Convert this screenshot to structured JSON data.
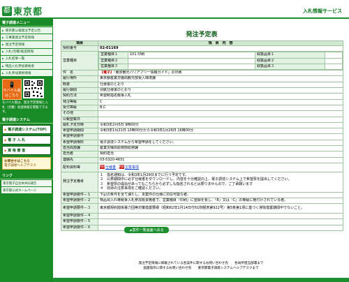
{
  "header": {
    "logo_text": "東京都",
    "logo_mark": "都",
    "service_title": "入札情報サービス"
  },
  "sidebar": {
    "menu_heading": "電子調達メニュー",
    "menu_items": [
      "東京都公報発注予定公告",
      "工事業発注予定情報",
      "発注予定情報",
      "入札(見積)経過情報",
      "入札結果一覧",
      "物品入札参加資格者",
      "入札参加資格情報"
    ],
    "mobile_label": "モバイル版",
    "mobile_sub": "はこちら",
    "mobile_text": "モバイル版は、発注予定情報と入札（見積）経過情報を閲覧できます。",
    "system_heading": "電子調達システム",
    "system_buttons": [
      "電子調達システム(TOP)",
      "電 子 入 札",
      "資 格 審 査"
    ],
    "promo_title": "お問合せはこちら",
    "promo_text": "電子調達ヘルプデスク",
    "links_heading": "リンク",
    "links": [
      "東京電子自治体共同運営",
      "東京都公式ホームページ"
    ]
  },
  "page_title": "発注予定表",
  "table": {
    "header_item": "項目",
    "header_content": "項　目　内　容",
    "contract_no_label": "契約番号",
    "contract_no": "02-01169",
    "business_type_label": "営業種目",
    "business_rows": [
      {
        "kind": "営業種目１",
        "number": "101 印刷",
        "tag": "取扱品目１"
      },
      {
        "kind": "営業種目２",
        "number": "",
        "tag": "取扱品目２"
      },
      {
        "kind": "営業種目３",
        "number": "",
        "tag": "取扱品目３"
      }
    ],
    "name_label": "件　名",
    "name_tag": "【電子】",
    "name_value": "「東京観光バリアフリー情報ガイド」の印刷",
    "place_label": "履行場所",
    "place_value": "東京都産業労働局観光部受入環境課",
    "summary_label": "概要",
    "summary_value": "仕様書のとおり",
    "period_label": "履行期間",
    "period_value": "別紙仕様書のとおり",
    "method_label": "契約方法",
    "method_value": "希望制指名競争入札",
    "rank_label": "発注等級",
    "rank_value": "C",
    "accept_rank_label": "受付等級",
    "accept_rank_value": "B,C",
    "other_label": "その他",
    "announce_label": "公報登載日",
    "announce_value": "",
    "open_label": "開札予定日時",
    "open_value": "令和3年2月5日 9時00分",
    "apply_period_label": "希望申請期間",
    "apply_period_value": "令和3年1月21日 10時00分から令和3年1月26日 16時00分",
    "apply_req_label": "希望申請要件",
    "apply_req_value": "",
    "apply_accept_label": "希望申請場所",
    "apply_accept_value": "電子調達システムから希望申請をしてください。",
    "dept_label": "担当局部課",
    "dept_value": "産業労働局総務部総務課",
    "person_label": "担当者",
    "person_value": "契約担当",
    "contact_label": "連絡先",
    "contact_value": "03-5320-4631",
    "docs_label": "配布資料等",
    "docs": [
      "仕様書",
      "注意事項"
    ],
    "notes_label": "発注予定備考",
    "notes": [
      "１　指名通知は、令和3年1月29日までに行う予定です。",
      "２　公表期間中に必ず仕様書をダウンロードし、内容を十分確認の上、電子調達システム上で希望票を提出してください。",
      "３　希望票の提出があってもこちらから必ずしも指名されるとは限りませんので、ご了承願います",
      "４　別添の注意事項をご確認ください。"
    ],
    "req_labels": [
      "希望申請要件－１",
      "希望申請要件－２",
      "希望申請要件－３",
      "希望申請要件－４",
      "希望申請要件－５",
      "希望申請要件－６"
    ],
    "req_values": [
      "下記の条件を全て満たし、本案件の仕様に対応可能な者。",
      "物品買入れ等競争入札参加有資格者で、営業種目「印刷」に登録を有し、「B」又は「C」の等級に格付けされている者。",
      "東京都契約関係暴力団等対策措置要綱（昭和62年1月14日付61財経庶第922号）第5条第1項に基づく排除措置期間中でないこと。",
      "",
      "",
      ""
    ]
  },
  "back_button": "案件一覧画面へ戻る",
  "footer": {
    "line1": "発注予定情報に掲載されている各案件に関するお問い合わせ先　　各局所担当部署まで",
    "line2": "画面操作に関するお問い合わせ先　　東京都電子調達システムヘルプデスクまで"
  },
  "colors": {
    "brand_green": "#1e8f2e",
    "label_bg": "#e3f3e3",
    "header_bg": "#cfe8cf",
    "accent_red": "#c00000"
  }
}
